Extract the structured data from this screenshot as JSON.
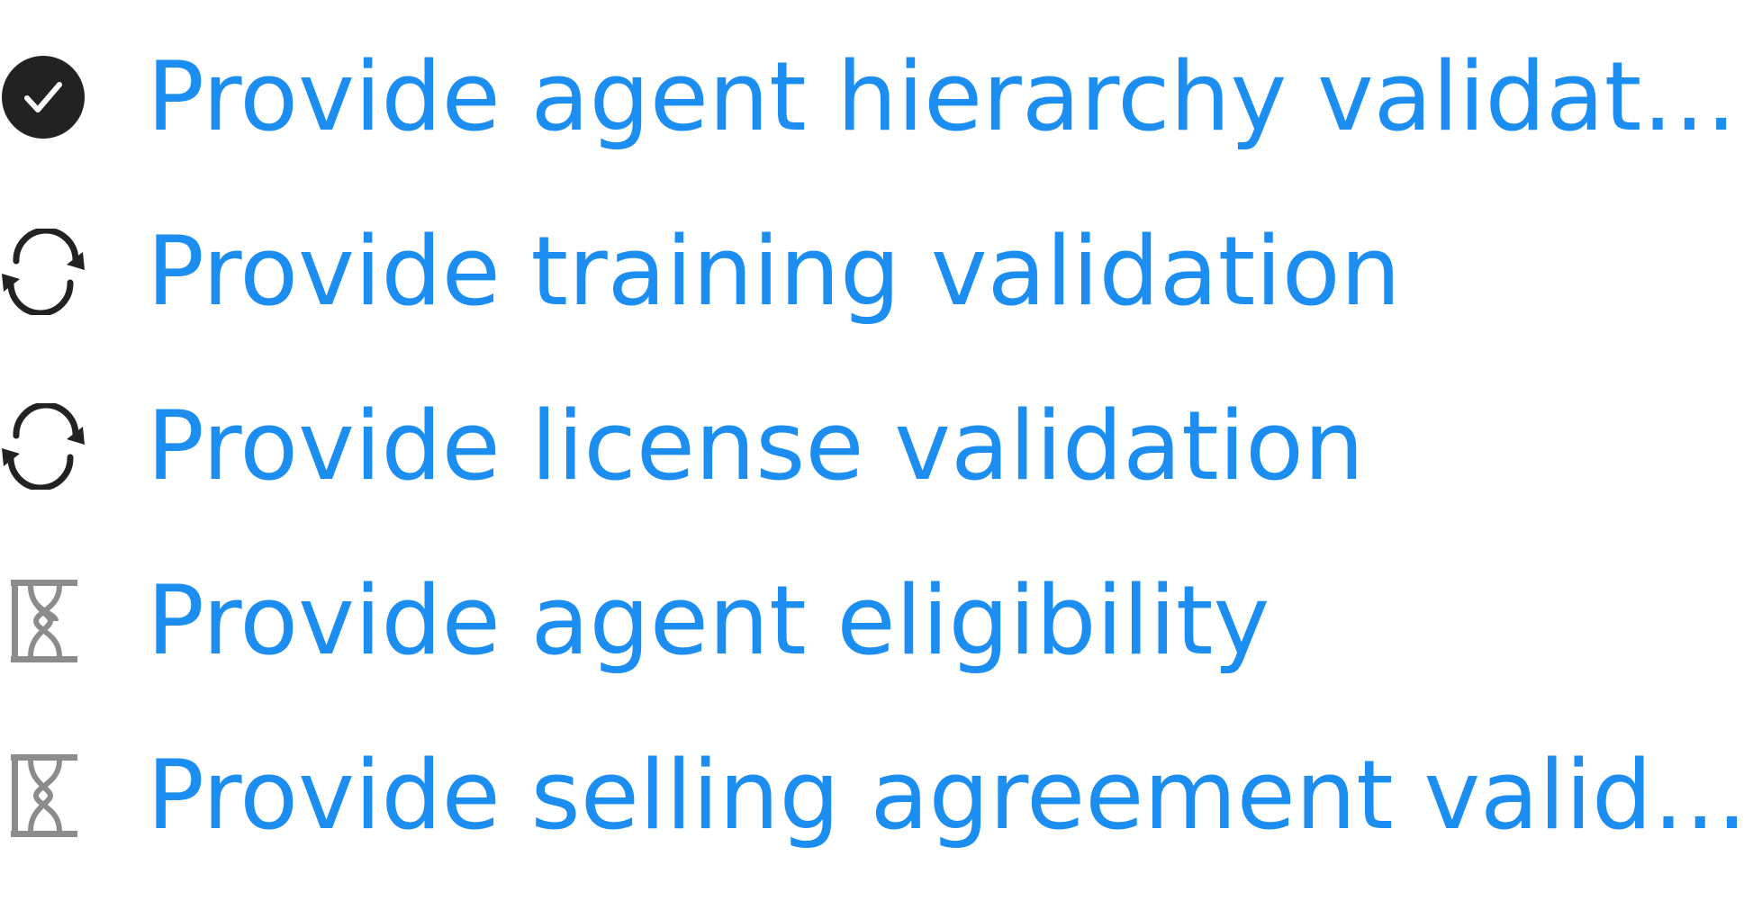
{
  "tasks": [
    {
      "label": "Provide agent hierarchy validation",
      "status": "completed",
      "icon": "check-circle-icon"
    },
    {
      "label": "Provide training validation",
      "status": "in-progress",
      "icon": "refresh-icon"
    },
    {
      "label": "Provide license validation",
      "status": "in-progress",
      "icon": "refresh-icon"
    },
    {
      "label": "Provide agent eligibility",
      "status": "pending",
      "icon": "hourglass-icon"
    },
    {
      "label": "Provide selling agreement valida…",
      "status": "pending",
      "icon": "hourglass-icon"
    }
  ],
  "colors": {
    "link": "#1c8ef2",
    "icon_dark": "#222222",
    "icon_gray": "#8c8c8c"
  }
}
